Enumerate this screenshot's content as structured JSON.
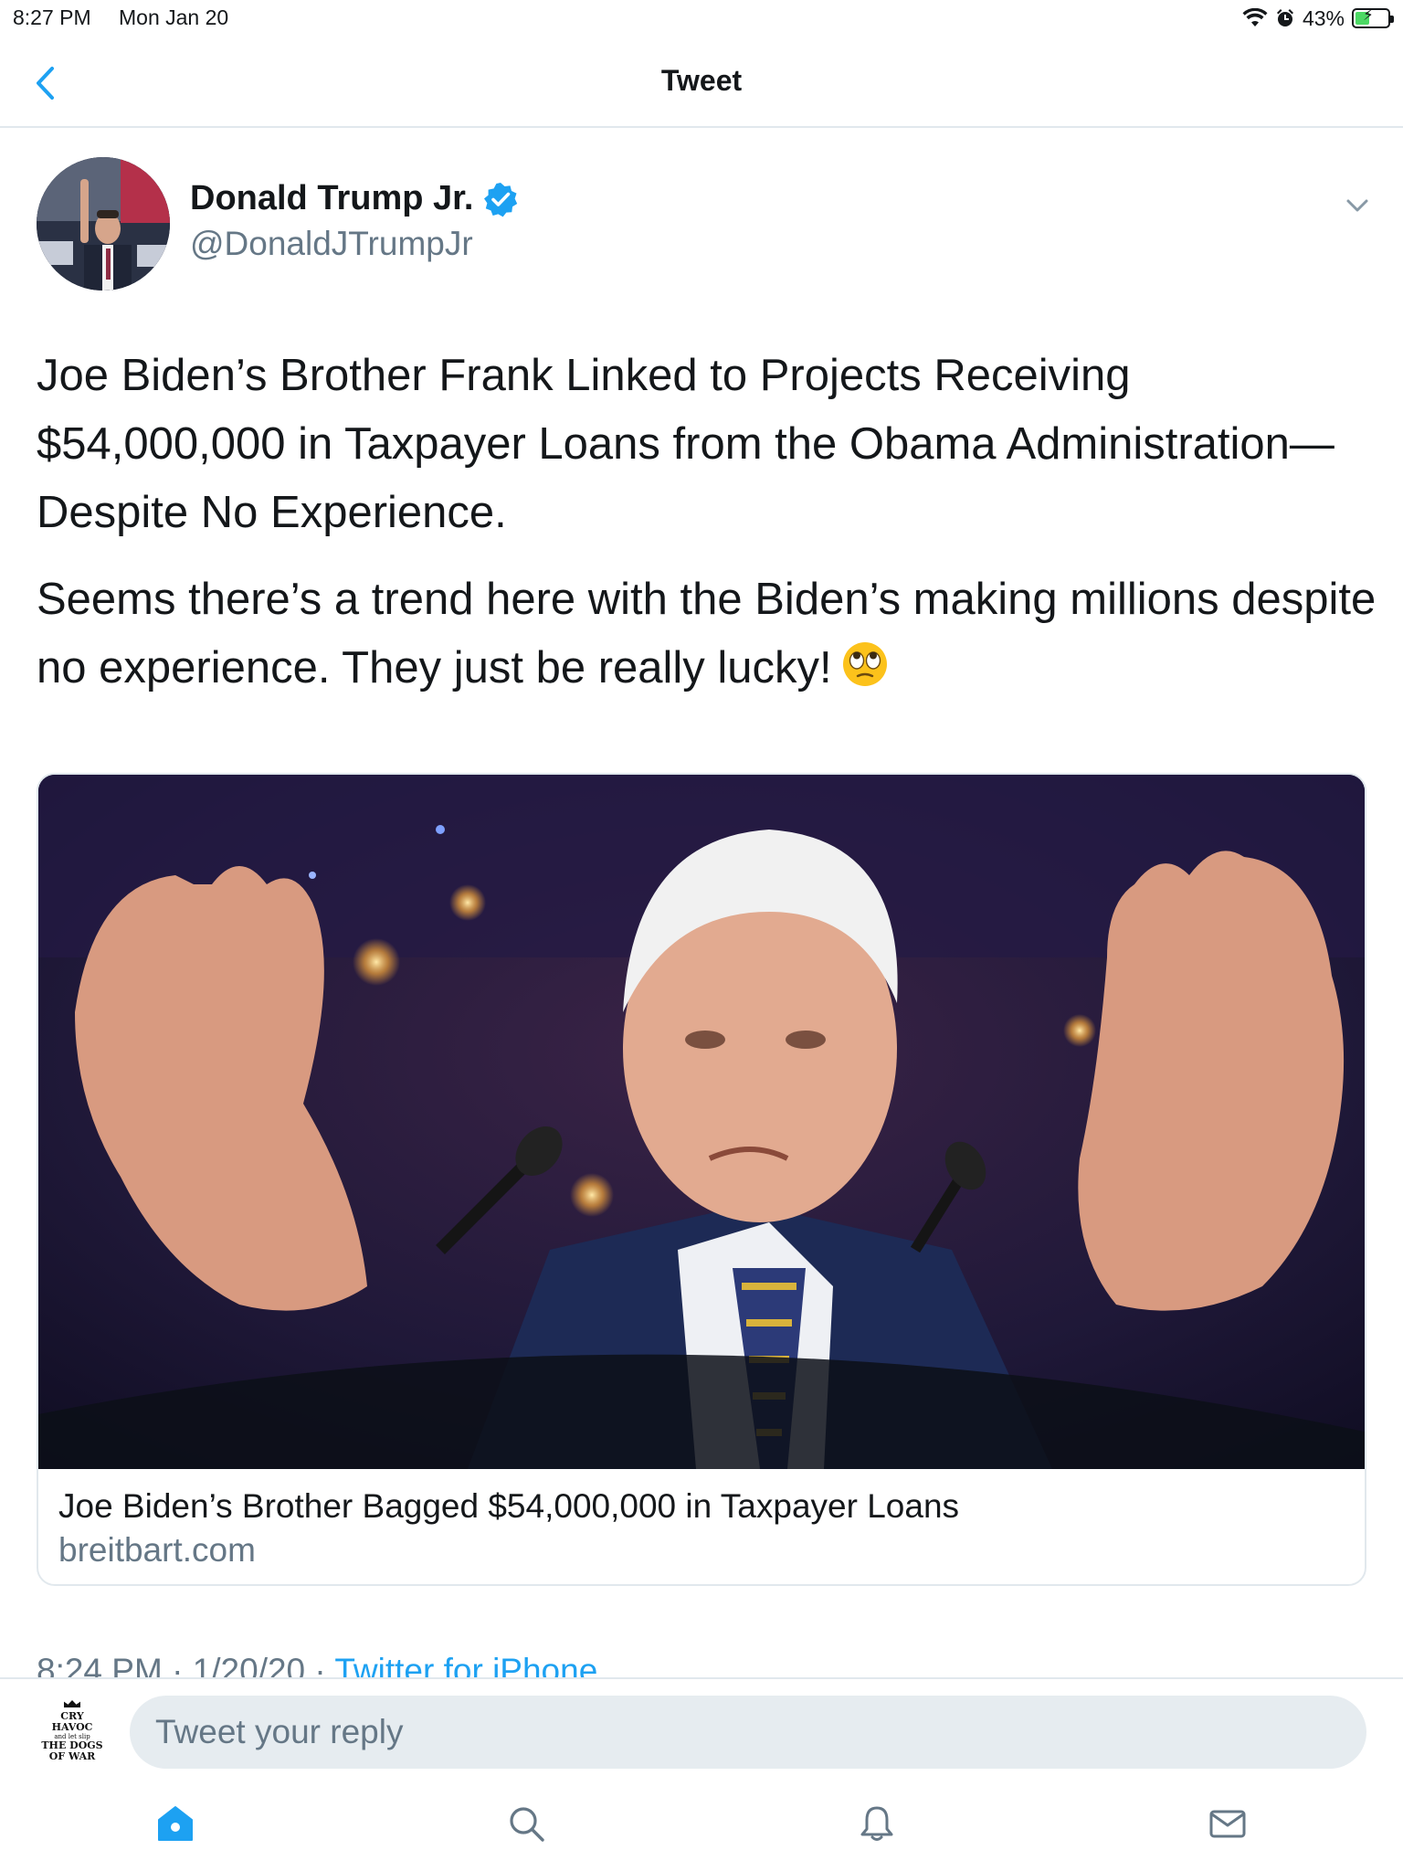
{
  "status_bar": {
    "time": "8:27 PM",
    "date": "Mon Jan 20",
    "battery_percent": "43%",
    "battery_level": 0.43,
    "icons": [
      "wifi-icon",
      "alarm-icon",
      "battery-charging-icon"
    ]
  },
  "nav": {
    "title": "Tweet",
    "back_icon": "chevron-left-icon"
  },
  "tweet": {
    "author": {
      "display_name": "Donald Trump Jr.",
      "handle": "@DonaldJTrumpJr",
      "verified": true
    },
    "paragraphs": [
      "Joe Biden’s Brother Frank Linked to Projects Receiving $54,000,000 in Taxpayer Loans from the Obama Administration—Despite No Experience.",
      "Seems there’s a trend here with the Biden’s making millions despite no experience. They just be really lucky!"
    ],
    "emoji": "face-with-rolling-eyes",
    "card": {
      "title": "Joe Biden’s Brother Bagged $54,000,000 in Taxpayer Loans",
      "domain": "breitbart.com"
    },
    "meta": {
      "time": "8:24 PM",
      "date": "1/20/20",
      "separator": "·",
      "source": "Twitter for iPhone"
    }
  },
  "reply": {
    "placeholder": "Tweet your reply",
    "avatar_text": [
      "CRY",
      "HAVOC",
      "and let slip",
      "THE DOGS",
      "OF WAR"
    ]
  },
  "tabs": [
    {
      "name": "home",
      "icon": "home-icon",
      "active": true
    },
    {
      "name": "search",
      "icon": "search-icon",
      "active": false
    },
    {
      "name": "notifications",
      "icon": "bell-icon",
      "active": false
    },
    {
      "name": "messages",
      "icon": "mail-icon",
      "active": false
    }
  ],
  "colors": {
    "accent": "#1da1f2",
    "secondary_text": "#657786",
    "divider": "#e1e8ed",
    "battery_fill": "#4cd964"
  }
}
